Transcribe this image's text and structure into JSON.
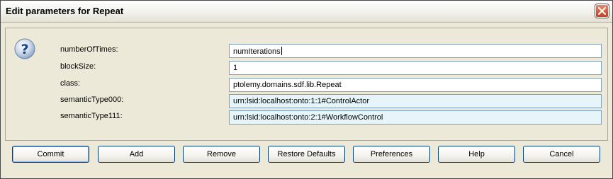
{
  "window": {
    "title": "Edit parameters for Repeat"
  },
  "params": [
    {
      "label": "numberOfTimes:",
      "value": "numIterations"
    },
    {
      "label": "blockSize:",
      "value": "1"
    },
    {
      "label": "class:",
      "value": "ptolemy.domains.sdf.lib.Repeat"
    },
    {
      "label": "semanticType000:",
      "value": "urn:lsid:localhost:onto:1:1#ControlActor"
    },
    {
      "label": "semanticType111:",
      "value": "urn:lsid:localhost:onto:2:1#WorkflowControl"
    }
  ],
  "buttons": {
    "commit": "Commit",
    "add": "Add",
    "remove": "Remove",
    "restore": "Restore Defaults",
    "preferences": "Preferences",
    "help": "Help",
    "cancel": "Cancel"
  },
  "colors": {
    "field_tint": "#e5f5f9",
    "close_button": "#d25634",
    "border_accent": "#7f9db9"
  },
  "icons": {
    "dialog": "question-icon",
    "close": "close-icon"
  }
}
